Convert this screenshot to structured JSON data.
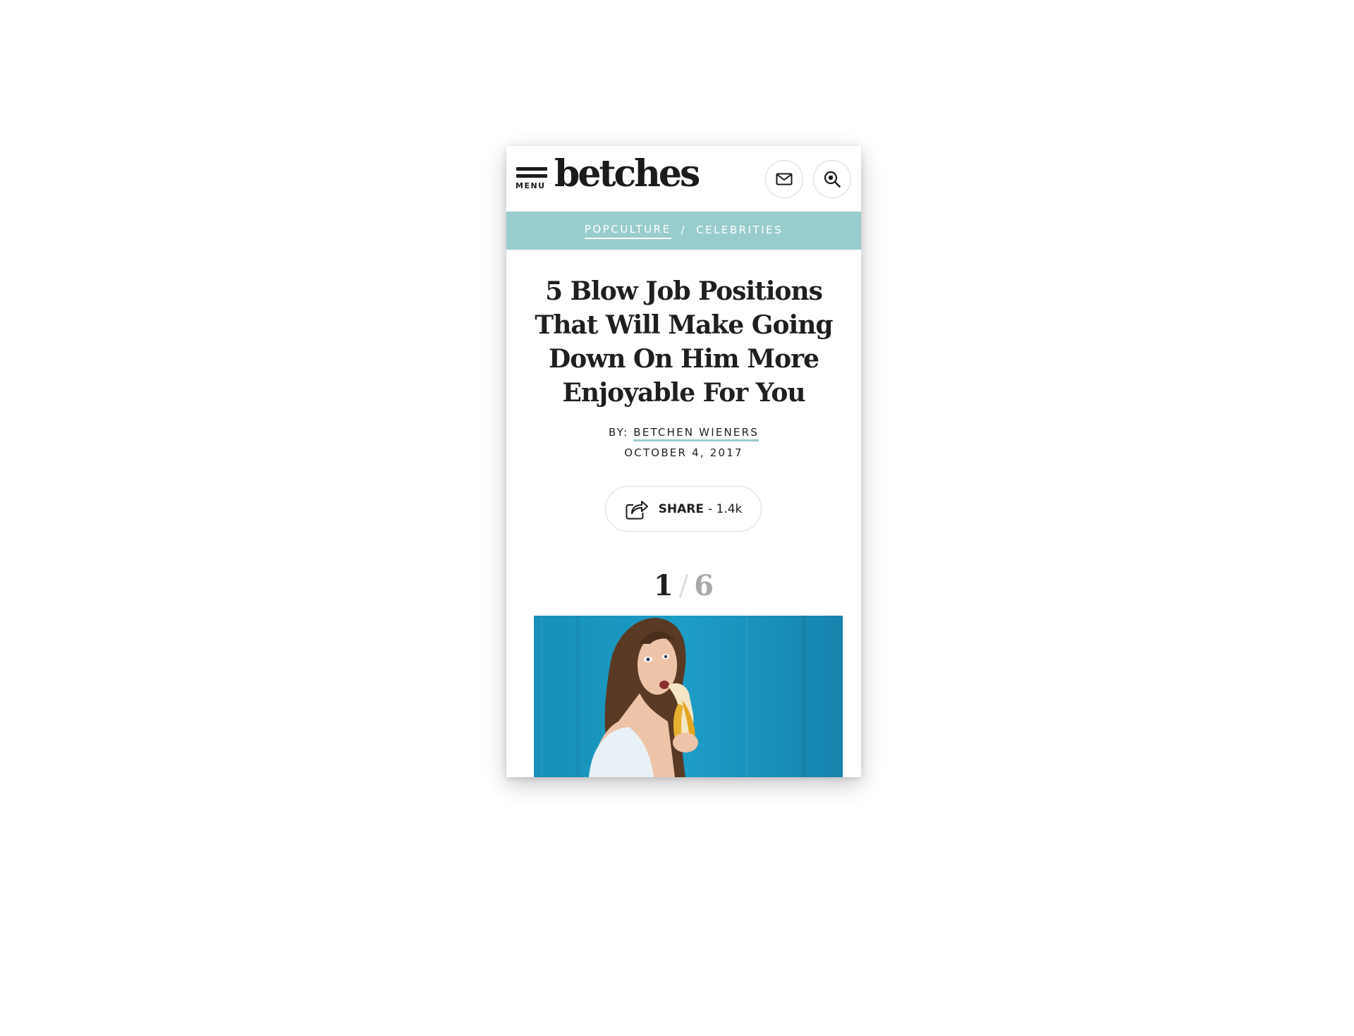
{
  "header": {
    "menu_label": "MENU",
    "logo_text": "betches"
  },
  "breadcrumb": {
    "items": [
      {
        "label": "POPCULTURE"
      },
      {
        "label": "CELEBRITIES"
      }
    ],
    "separator": "/"
  },
  "article": {
    "title": "5 Blow Job Positions That Will Make Going Down On Him More Enjoyable For You",
    "byline_prefix": "BY:",
    "author": "BETCHEN WIENERS",
    "date": "OCTOBER 4, 2017"
  },
  "share": {
    "label": "SHARE",
    "count": "- 1.4k"
  },
  "slideshow": {
    "current": "1",
    "separator": "/",
    "total": "6"
  },
  "icons": {
    "menu": "hamburger-icon",
    "mail": "mail-icon",
    "search": "search-icon",
    "share": "share-icon"
  },
  "colors": {
    "accent": "#99cccc",
    "text": "#1f1f1f",
    "hero_background": "#1a9ac4"
  }
}
